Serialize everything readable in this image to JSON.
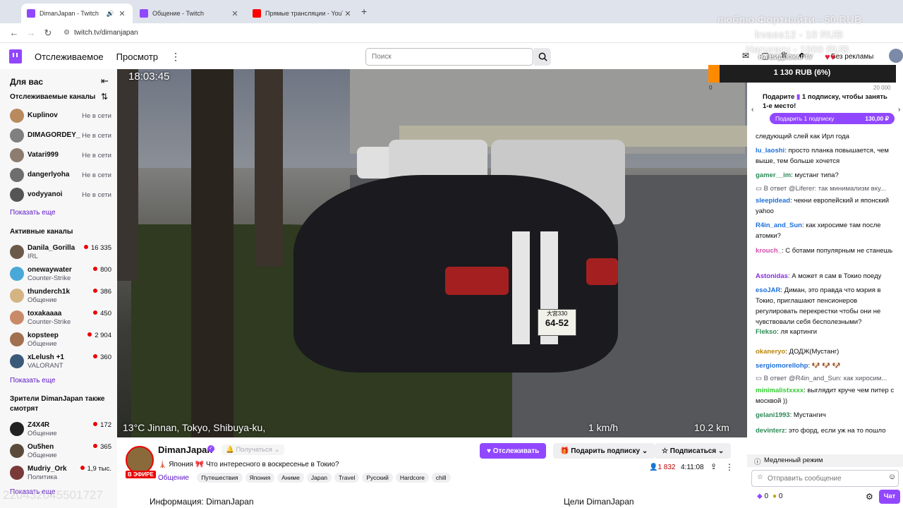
{
  "browser": {
    "tabs": [
      {
        "title": "DimanJapan - Twitch",
        "color": "#9147ff"
      },
      {
        "title": "Общение - Twitch",
        "color": "#9147ff"
      },
      {
        "title": "Прямые трансляции - YouTube",
        "color": "#ff0000"
      }
    ],
    "url": "twitch.tv/dimanjapan"
  },
  "header": {
    "following": "Отслеживаемое",
    "browse": "Просмотр",
    "search_placeholder": "Поиск",
    "ad_label": "Без рекламы"
  },
  "sidebar": {
    "for_you": "Для вас",
    "followed_title": "Отслеживаемые каналы",
    "followed": [
      {
        "name": "Kuplinov",
        "status": "Не в сети",
        "color": "#b88a5e"
      },
      {
        "name": "DIMAGORDEY_",
        "status": "Не в сети",
        "color": "#808080"
      },
      {
        "name": "Vatari999",
        "status": "Не в сети",
        "color": "#8c7d6e"
      },
      {
        "name": "dangerlyoha",
        "status": "Не в сети",
        "color": "#6e6e6e"
      },
      {
        "name": "vodyyanoi",
        "status": "Не в сети",
        "color": "#555555"
      }
    ],
    "show_more_1": "Показать еще",
    "active_title": "Активные каналы",
    "active": [
      {
        "name": "Danila_Gorilla",
        "sub": "IRL",
        "viewers": "16 335",
        "color": "#6b5a4a"
      },
      {
        "name": "onewaywater",
        "sub": "Counter-Strike",
        "viewers": "800",
        "color": "#4aa8d8"
      },
      {
        "name": "thunderch1k",
        "sub": "Общение",
        "viewers": "386",
        "color": "#d4b483"
      },
      {
        "name": "toxakaaaa",
        "sub": "Counter-Strike",
        "viewers": "450",
        "color": "#c98a6a"
      },
      {
        "name": "kopsteep",
        "sub": "Общение",
        "viewers": "2 904",
        "color": "#a07050"
      },
      {
        "name": "xLelush +1",
        "sub": "VALORANT",
        "viewers": "360",
        "color": "#3a5a7a"
      }
    ],
    "show_more_2": "Показать еще",
    "also_title_1": "Зрители DimanJapan также",
    "also_title_2": "смотрят",
    "also": [
      {
        "name": "Z4X4R",
        "sub": "Общение",
        "viewers": "172",
        "color": "#222222"
      },
      {
        "name": "Ou5hen",
        "sub": "Общение",
        "viewers": "365",
        "color": "#5a4a3a"
      },
      {
        "name": "Mudriy_Ork",
        "sub": "Политика",
        "viewers": "1,9 тыс.",
        "color": "#7a3a3a"
      }
    ],
    "show_more_3": "Показать еще"
  },
  "video": {
    "time": "18:03:45",
    "location": "13°C  Jinnan, Tokyo, Shibuya-ku,",
    "speed": "1 km/h",
    "distance": "10.2 km",
    "plate_top": "大宮330",
    "plate_num": "64-52"
  },
  "stream": {
    "channel": "DimanJapan",
    "live": "В ЭФИРЕ",
    "title": "🗼 Япония 🎀 Что интересного в воскресенье в Токио?",
    "category": "Общение",
    "tags": [
      "Путешествия",
      "Япония",
      "Аниме",
      "Japan",
      "Travel",
      "Русский",
      "Hardcore",
      "chill"
    ],
    "viewers": "1 832",
    "uptime": "4:11:08",
    "notify": "Получаться",
    "follow": "Отслеживать",
    "gift": "Подарить подписку",
    "subscribe": "Подписаться",
    "about": "Информация: DimanJapan",
    "goals": "Цели DimanJapan"
  },
  "overlay": {
    "donate1": "люблю Фортнайти - 50 RUB",
    "donate2": "kvass12 - 10 RUB",
    "donate3": "Haruraru - 1000 RUB",
    "goal_label": "НА ВИДЕОКАРТУ",
    "goal_amount": "1 130 RUB (6%)",
    "goal_min": "0",
    "goal_max": "20 000",
    "goal_fraction": 0.06,
    "stream_id": "220432045501727"
  },
  "chat": {
    "gift_prompt_1": "Подарите",
    "gift_prompt_2": "1 подписку, чтобы занять",
    "gift_prompt_3": "1-е место!",
    "gift_btn": "Подарить 1 подписку",
    "gift_price": "130,00 ₽",
    "messages": [
      {
        "user": "",
        "text": "следующий слей как Ирл года",
        "color": "#0e0e10"
      },
      {
        "user": "lu_laoshi",
        "text": "просто планка повышается, чем выше, тем больше хочется",
        "color": "#1e6fd9"
      },
      {
        "user": "gamer__im",
        "text": "мустанг типа?",
        "color": "#2e8b57"
      },
      {
        "reply": "В ответ @Liferer: так минимализм вку..."
      },
      {
        "user": "sleepidead",
        "text": "чекни европейский и японский yahoo",
        "color": "#1e6fd9"
      },
      {
        "user": "R4in_and_Sun",
        "text": "как хиросиме там после атомки?",
        "color": "#1e6fd9"
      },
      {
        "user": "krouch_",
        "text": "С ботами популярным не станешь",
        "color": "#d24ca8"
      },
      {
        "user": "Astonidas",
        "text": "А может я сам в Токио поеду",
        "color": "#8a2be2"
      },
      {
        "user": "esoJAR",
        "text": "Диман, это правда что мэрия в Токио, приглашают пенсионеров регулировать перекрестки чтобы они не чувствовали себя бесполезными?",
        "color": "#1e6fd9"
      },
      {
        "user": "Flekso",
        "text": "ля картинги",
        "color": "#2e8b57"
      },
      {
        "user": "okaneryo",
        "text": "ДОДЖ(Мустанг)",
        "color": "#b8860b"
      },
      {
        "user": "sergiomorellohp",
        "text": "",
        "color": "#1e6fd9"
      },
      {
        "reply": "В ответ @R4in_and_Sun: как хиросим..."
      },
      {
        "user": "minimalistxxxx",
        "text": "выглядит круче чем питер с москвой ))",
        "color": "#32cd32"
      },
      {
        "user": "gelani1993",
        "text": "Мустангич",
        "color": "#2e8b57"
      },
      {
        "user": "devinterz",
        "text": "это форд, если уж на то пошло",
        "color": "#2e8b57"
      }
    ],
    "slow_mode": "Медленный режим",
    "input_placeholder": "Отправить сообщение",
    "points": "0",
    "bits": "0",
    "chat_btn": "Чат"
  }
}
